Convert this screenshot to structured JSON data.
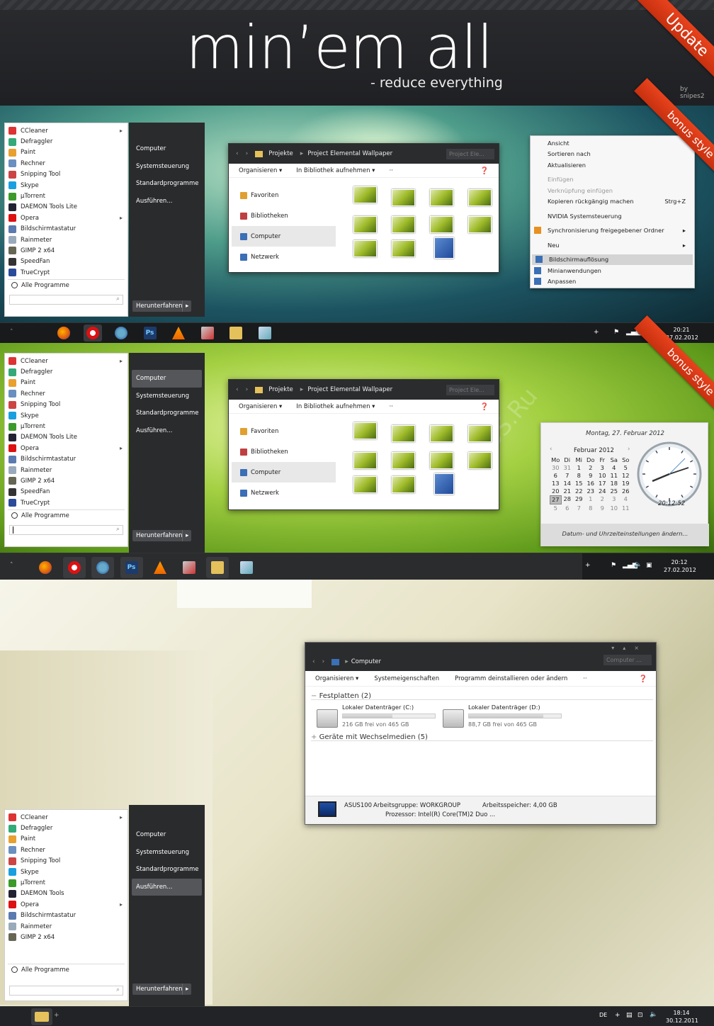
{
  "header": {
    "title": "min’em all",
    "subtitle": "- reduce everything",
    "byline": "by snipes2",
    "update_ribbon": "Update",
    "bonus_ribbon": "bonus style"
  },
  "startmenu_items": [
    "CCleaner",
    "Defraggler",
    "Paint",
    "Rechner",
    "Snipping Tool",
    "Skype",
    "µTorrent",
    "DAEMON Tools Lite",
    "Opera",
    "Bildschirmtastatur",
    "Rainmeter",
    "GIMP 2 x64",
    "SpeedFan",
    "TrueCrypt"
  ],
  "startmenu3_items": [
    "CCleaner",
    "Defraggler",
    "Paint",
    "Rechner",
    "Snipping Tool",
    "Skype",
    "µTorrent",
    "DAEMON Tools",
    "Opera",
    "Bildschirmtastatur",
    "Rainmeter",
    "GIMP 2 x64"
  ],
  "startmenu_all_programs": "Alle Programme",
  "startmenu_right": [
    "Computer",
    "Systemsteuerung",
    "Standardprogramme",
    "Ausführen..."
  ],
  "shutdown_label": "Herunterfahren",
  "explorer": {
    "crumbs": [
      "Projekte",
      "Project Elemental Wallpaper"
    ],
    "search_placeholder": "Project Ele...",
    "commands": [
      "Organisieren ▾",
      "In Bibliothek aufnehmen ▾",
      "··"
    ],
    "nav": [
      "Favoriten",
      "Bibliotheken",
      "Computer",
      "Netzwerk"
    ]
  },
  "context_menu": [
    {
      "label": "Ansicht"
    },
    {
      "label": "Sortieren nach"
    },
    {
      "label": "Aktualisieren"
    },
    {
      "sep": true
    },
    {
      "label": "Einfügen",
      "disabled": true
    },
    {
      "label": "Verknüpfung einfügen",
      "disabled": true
    },
    {
      "label": "Kopieren rückgängig machen",
      "shortcut": "Strg+Z"
    },
    {
      "sep": true
    },
    {
      "label": "NVIDIA Systemsteuerung"
    },
    {
      "sep": true
    },
    {
      "label": "Synchronisierung freigegebener Ordner",
      "shortcut": "▸"
    },
    {
      "sep": true
    },
    {
      "label": "Neu",
      "shortcut": "▸"
    },
    {
      "sep": true
    },
    {
      "label": "Bildschirmauflösung",
      "selected": true
    },
    {
      "label": "Minianwendungen"
    },
    {
      "label": "Anpassen"
    }
  ],
  "taskbar1": {
    "time": "20:21",
    "date": "27.02.2012"
  },
  "taskbar2": {
    "time": "20:12",
    "date": "27.02.2012"
  },
  "taskbar3": {
    "time": "18:14",
    "date": "30.12.2011",
    "lang": "DE"
  },
  "calendar": {
    "heading": "Montag, 27. Februar 2012",
    "month": "Februar 2012",
    "weekdays": [
      "Mo",
      "Di",
      "Mi",
      "Do",
      "Fr",
      "Sa",
      "So"
    ],
    "days": [
      "30",
      "31",
      "1",
      "2",
      "3",
      "4",
      "5",
      "6",
      "7",
      "8",
      "9",
      "10",
      "11",
      "12",
      "13",
      "14",
      "15",
      "16",
      "17",
      "18",
      "19",
      "20",
      "21",
      "22",
      "23",
      "24",
      "25",
      "26",
      "27",
      "28",
      "29",
      "1",
      "2",
      "3",
      "4",
      "5",
      "6",
      "7",
      "8",
      "9",
      "10",
      "11"
    ],
    "time": "20:12:52",
    "link": "Datum- und Uhrzeiteinstellungen ändern..."
  },
  "watermark": "All4oS.Ru",
  "computer_window": {
    "crumb": "Computer",
    "search_placeholder": "Computer ...",
    "commands": [
      "Organisieren ▾",
      "Systemeigenschaften",
      "Programm deinstallieren oder ändern",
      "··"
    ],
    "group1": "Festplatten (2)",
    "drives": [
      {
        "name": "Lokaler Datenträger (C:)",
        "free": "216 GB frei von 465 GB",
        "used_fraction": 0.54
      },
      {
        "name": "Lokaler Datenträger (D:)",
        "free": "88,7 GB frei von 465 GB",
        "used_fraction": 0.81
      }
    ],
    "group2": "Geräte mit Wechselmedien (5)",
    "pc_name": "ASUS100",
    "workgroup": "Arbeitsgruppe: WORKGROUP",
    "memory": "Arbeitsspeicher: 4,00 GB",
    "processor": "Prozessor: Intel(R) Core(TM)2 Duo ..."
  }
}
